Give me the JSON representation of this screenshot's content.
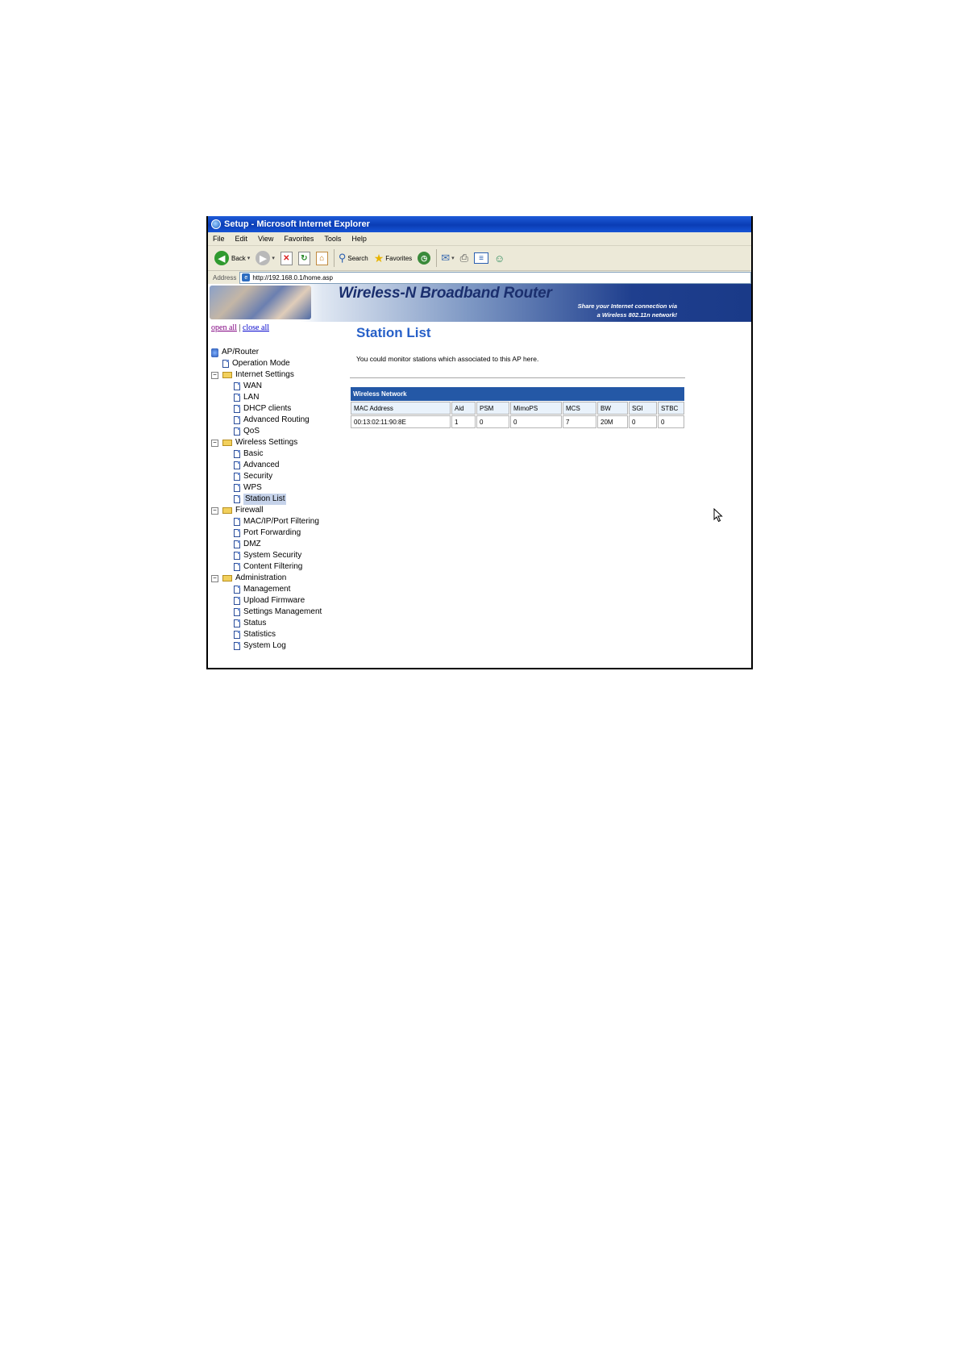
{
  "window": {
    "title": "Setup - Microsoft Internet Explorer"
  },
  "menu": [
    "File",
    "Edit",
    "View",
    "Favorites",
    "Tools",
    "Help"
  ],
  "toolbar": {
    "back_label": "Back",
    "search_label": "Search",
    "favorites_label": "Favorites"
  },
  "address": {
    "label": "Address",
    "url": "http://192.168.0.1/home.asp"
  },
  "banner": {
    "title": "Wireless-N Broadband Router",
    "tagline_line1": "Share your Internet connection via",
    "tagline_line2": "a Wireless 802.11n network!"
  },
  "nav_links": {
    "open_all": "open all",
    "separator": "|",
    "close_all": "close all"
  },
  "tree": {
    "root": "AP/Router",
    "operation_mode": "Operation Mode",
    "internet_settings": {
      "label": "Internet Settings",
      "items": [
        "WAN",
        "LAN",
        "DHCP clients",
        "Advanced Routing",
        "QoS"
      ]
    },
    "wireless_settings": {
      "label": "Wireless Settings",
      "items": [
        "Basic",
        "Advanced",
        "Security",
        "WPS",
        "Station List"
      ]
    },
    "firewall": {
      "label": "Firewall",
      "items": [
        "MAC/IP/Port Filtering",
        "Port Forwarding",
        "DMZ",
        "System Security",
        "Content Filtering"
      ]
    },
    "administration": {
      "label": "Administration",
      "items": [
        "Management",
        "Upload Firmware",
        "Settings Management",
        "Status",
        "Statistics",
        "System Log"
      ]
    },
    "expanded_marker": "−",
    "selected": "Station List"
  },
  "main": {
    "title": "Station List",
    "description": "You could monitor stations which associated to this AP here.",
    "table": {
      "caption": "Wireless Network",
      "columns": [
        "MAC Address",
        "Aid",
        "PSM",
        "MimoPS",
        "MCS",
        "BW",
        "SGI",
        "STBC"
      ],
      "rows": [
        [
          "00:13:02:11:90:8E",
          "1",
          "0",
          "0",
          "7",
          "20M",
          "0",
          "0"
        ]
      ]
    }
  },
  "colors": {
    "titlebar": "#0a3db5",
    "chrome": "#ece9d8",
    "page_title": "#2760c8",
    "table_header": "#2458a6",
    "banner_dark": "#1a3a88"
  }
}
